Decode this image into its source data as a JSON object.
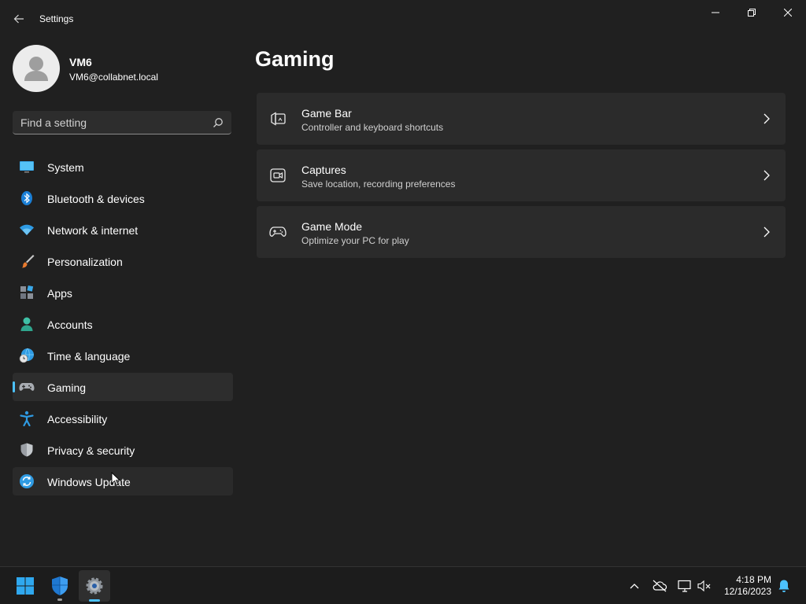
{
  "window": {
    "title": "Settings"
  },
  "profile": {
    "name": "VM6",
    "email": "VM6@collabnet.local"
  },
  "search": {
    "placeholder": "Find a setting",
    "value": ""
  },
  "sidebar": {
    "items": [
      {
        "label": "System",
        "icon": "monitor-icon"
      },
      {
        "label": "Bluetooth & devices",
        "icon": "bluetooth-icon"
      },
      {
        "label": "Network & internet",
        "icon": "wifi-icon"
      },
      {
        "label": "Personalization",
        "icon": "paintbrush-icon"
      },
      {
        "label": "Apps",
        "icon": "apps-grid-icon"
      },
      {
        "label": "Accounts",
        "icon": "person-icon"
      },
      {
        "label": "Time & language",
        "icon": "globe-clock-icon"
      },
      {
        "label": "Gaming",
        "icon": "gamepad-icon",
        "selected": true
      },
      {
        "label": "Accessibility",
        "icon": "accessibility-person-icon"
      },
      {
        "label": "Privacy & security",
        "icon": "shield-icon"
      },
      {
        "label": "Windows Update",
        "icon": "refresh-icon",
        "hovered": true
      }
    ]
  },
  "main": {
    "title": "Gaming",
    "cards": [
      {
        "title": "Game Bar",
        "subtitle": "Controller and keyboard shortcuts",
        "icon": "game-bar-icon"
      },
      {
        "title": "Captures",
        "subtitle": "Save location, recording preferences",
        "icon": "capture-icon"
      },
      {
        "title": "Game Mode",
        "subtitle": "Optimize your PC for play",
        "icon": "gamepad-icon"
      }
    ]
  },
  "taskbar": {
    "apps": [
      "windows-start-icon",
      "defender-shield-icon",
      "settings-gear-icon"
    ],
    "time": "4:18 PM",
    "date": "12/16/2023"
  },
  "colors": {
    "accent": "#4cc2ff",
    "background": "#202020",
    "card": "#2b2b2b"
  }
}
